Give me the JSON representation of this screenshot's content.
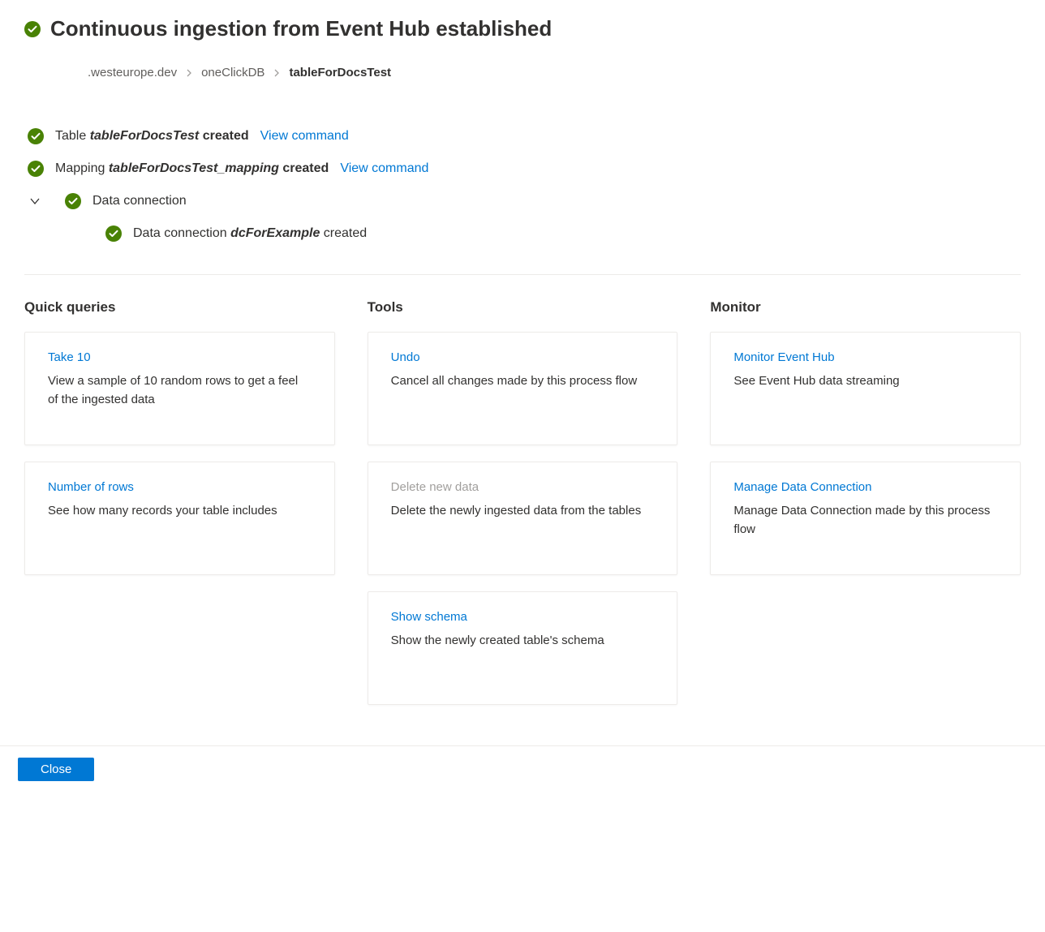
{
  "header": {
    "title": "Continuous ingestion from Event Hub established"
  },
  "breadcrumb": {
    "cluster": ".westeurope.dev",
    "database": "oneClickDB",
    "table": "tableForDocsTest"
  },
  "status": {
    "table_prefix": "Table ",
    "table_name": "tableForDocsTest",
    "table_suffix": " created",
    "view_command": "View command",
    "mapping_prefix": "Mapping ",
    "mapping_name": "tableForDocsTest_mapping",
    "mapping_suffix": " created",
    "data_connection_label": "Data connection",
    "dc_prefix": "Data connection ",
    "dc_name": "dcForExample",
    "dc_suffix": " created"
  },
  "sections": {
    "quick_queries": {
      "header": "Quick queries",
      "cards": [
        {
          "title": "Take 10",
          "desc": "View a sample of 10 random rows to get a feel of the ingested data",
          "disabled": false
        },
        {
          "title": "Number of rows",
          "desc": "See how many records your table includes",
          "disabled": false
        }
      ]
    },
    "tools": {
      "header": "Tools",
      "cards": [
        {
          "title": "Undo",
          "desc": "Cancel all changes made by this process flow",
          "disabled": false
        },
        {
          "title": "Delete new data",
          "desc": "Delete the newly ingested data from the tables",
          "disabled": true
        },
        {
          "title": "Show schema",
          "desc": "Show the newly created table's schema",
          "disabled": false
        }
      ]
    },
    "monitor": {
      "header": "Monitor",
      "cards": [
        {
          "title": "Monitor Event Hub",
          "desc": "See Event Hub data streaming",
          "disabled": false
        },
        {
          "title": "Manage Data Connection",
          "desc": "Manage Data Connection made by this process flow",
          "disabled": false
        }
      ]
    }
  },
  "footer": {
    "close": "Close"
  }
}
